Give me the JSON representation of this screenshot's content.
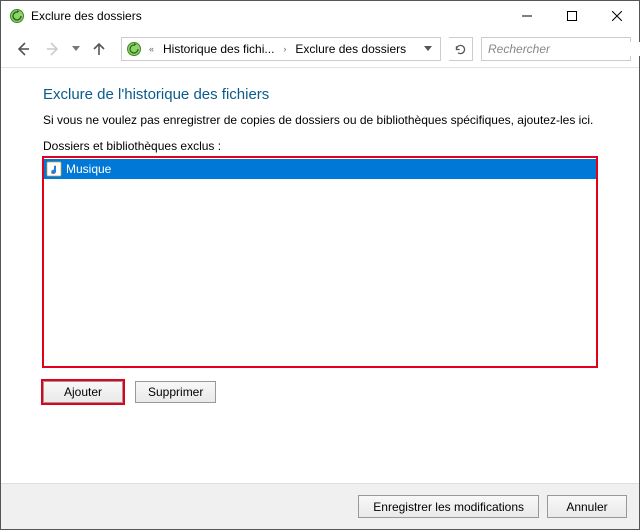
{
  "window": {
    "title": "Exclure des dossiers"
  },
  "breadcrumb": {
    "item1": "Historique des fichi...",
    "item2": "Exclure des dossiers"
  },
  "search": {
    "placeholder": "Rechercher"
  },
  "main": {
    "heading": "Exclure de l'historique des fichiers",
    "description": "Si vous ne voulez pas enregistrer de copies de dossiers ou de bibliothèques spécifiques, ajoutez-les ici.",
    "list_label": "Dossiers et bibliothèques exclus :",
    "items": [
      {
        "label": "Musique"
      }
    ],
    "add_button": "Ajouter",
    "remove_button": "Supprimer"
  },
  "footer": {
    "save": "Enregistrer les modifications",
    "cancel": "Annuler"
  }
}
